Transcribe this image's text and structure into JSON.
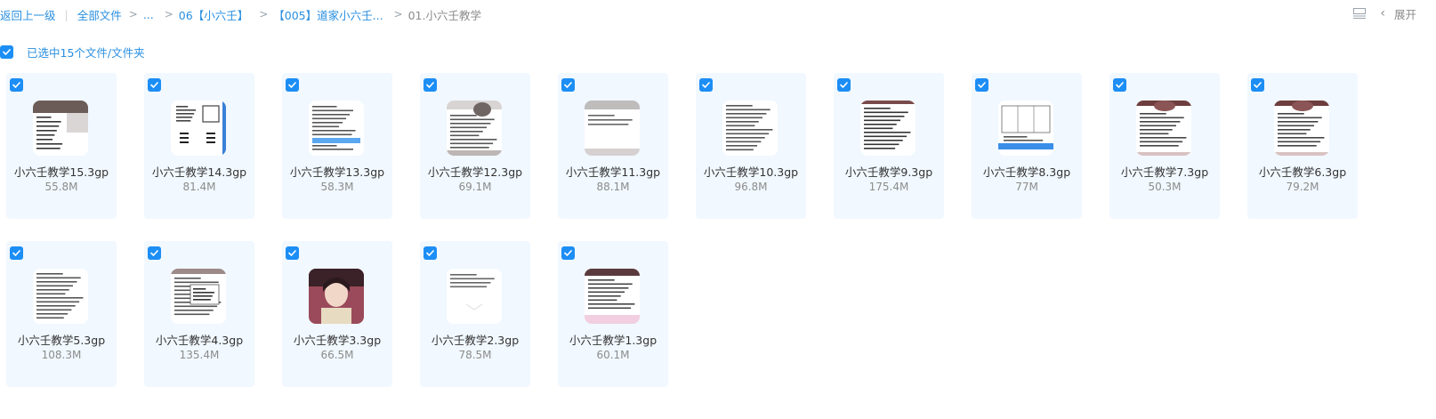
{
  "breadcrumb": {
    "back": "返回上一级",
    "all_files": "全部文件",
    "ellipsis": "...",
    "folder_1": "06【小六壬】",
    "folder_2": "【005】道家小六壬...",
    "current": "01.小六壬教学",
    "separator": ">"
  },
  "toolbar": {
    "expand_label": "展开",
    "view_icon": "list-view-icon",
    "chevron_icon": "chevron-left-icon"
  },
  "selection": {
    "text": "已选中15个文件/文件夹"
  },
  "colors": {
    "accent": "#1c8ef5",
    "card_bg": "#f1f8ff",
    "link": "#2a8fe0"
  },
  "files": [
    {
      "name": "小六壬教学15.3gp",
      "size": "55.8M",
      "thumb": "video-frame-person"
    },
    {
      "name": "小六壬教学14.3gp",
      "size": "81.4M",
      "thumb": "document-diagram"
    },
    {
      "name": "小六壬教学13.3gp",
      "size": "58.3M",
      "thumb": "document-highlight"
    },
    {
      "name": "小六壬教学12.3gp",
      "size": "69.1M",
      "thumb": "document-person"
    },
    {
      "name": "小六壬教学11.3gp",
      "size": "88.1M",
      "thumb": "whiteboard"
    },
    {
      "name": "小六壬教学10.3gp",
      "size": "96.8M",
      "thumb": "document-text"
    },
    {
      "name": "小六壬教学9.3gp",
      "size": "175.4M",
      "thumb": "document-text-dark"
    },
    {
      "name": "小六壬教学8.3gp",
      "size": "77M",
      "thumb": "document-table"
    },
    {
      "name": "小六壬教学7.3gp",
      "size": "50.3M",
      "thumb": "document-person-top"
    },
    {
      "name": "小六壬教学6.3gp",
      "size": "79.2M",
      "thumb": "document-person-top"
    },
    {
      "name": "小六壬教学5.3gp",
      "size": "108.3M",
      "thumb": "document-text"
    },
    {
      "name": "小六壬教学4.3gp",
      "size": "135.4M",
      "thumb": "document-dialog"
    },
    {
      "name": "小六壬教学3.3gp",
      "size": "66.5M",
      "thumb": "person-photo"
    },
    {
      "name": "小六壬教学2.3gp",
      "size": "78.5M",
      "thumb": "document-blank"
    },
    {
      "name": "小六壬教学1.3gp",
      "size": "60.1M",
      "thumb": "document-person-bottom"
    }
  ]
}
